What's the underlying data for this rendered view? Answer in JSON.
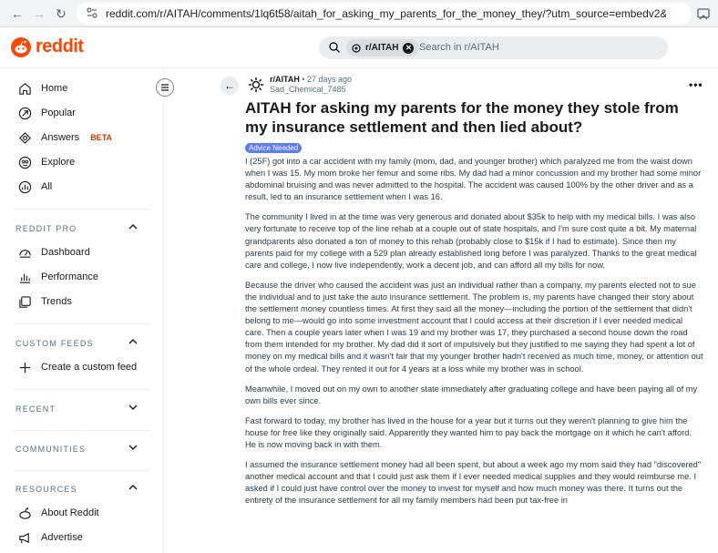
{
  "browser": {
    "url": "reddit.com/r/AITAH/comments/1lq6t58/aitah_for_asking_my_parents_for_the_money_they/?utm_source=embedv2&utm_med..."
  },
  "header": {
    "logo_text": "reddit",
    "search": {
      "chip": "r/AITAH",
      "placeholder": "Search in r/AITAH"
    }
  },
  "sidebar": {
    "main_nav": [
      {
        "label": "Home",
        "icon": "home-icon"
      },
      {
        "label": "Popular",
        "icon": "popular-icon"
      },
      {
        "label": "Answers",
        "badge": "BETA",
        "icon": "answers-icon"
      },
      {
        "label": "Explore",
        "icon": "explore-icon"
      },
      {
        "label": "All",
        "icon": "all-icon"
      }
    ],
    "reddit_pro": {
      "title": "REDDIT PRO",
      "items": [
        {
          "label": "Dashboard",
          "icon": "dashboard-icon"
        },
        {
          "label": "Performance",
          "icon": "performance-icon"
        },
        {
          "label": "Trends",
          "icon": "trends-icon"
        }
      ]
    },
    "custom_feeds": {
      "title": "CUSTOM FEEDS",
      "create_label": "Create a custom feed"
    },
    "recent": {
      "title": "RECENT"
    },
    "communities": {
      "title": "COMMUNITIES"
    },
    "resources": {
      "title": "RESOURCES",
      "items": [
        {
          "label": "About Reddit",
          "icon": "about-icon"
        },
        {
          "label": "Advertise",
          "icon": "advertise-icon"
        }
      ]
    }
  },
  "post": {
    "subreddit": "r/AITAH",
    "time": "• 27 days ago",
    "author": "Sad_Chemical_7485",
    "title": "AITAH for asking my parents for the money they stole from my insurance settlement and then lied about?",
    "flair": "Advice Needed",
    "paragraphs": [
      "I (25F) got into a car accident with my family (mom, dad, and younger brother) which paralyzed me from the waist down when I was 15. My mom broke her femur and some ribs. My dad had a minor concussion and my brother had some minor abdominal bruising and was never admitted to the hospital. The accident was caused 100% by the other driver and as a result, led to an insurance settlement when I was 16.",
      "The community I lived in at the time was very generous and donated about $35k to help with my medical bills. I was also very fortunate to receive top of the line rehab at a couple out of state hospitals, and I'm sure cost quite a bit. My maternal grandparents also donated a ton of money to this rehab (probably close to $15k if I had to estimate). Since then my parents paid for my college with a 529 plan already established long before I was paralyzed. Thanks to the great medical care and college, I now live independently, work a decent job, and can afford all my bills for now.",
      "Because the driver who caused the accident was just an individual rather than a company, my parents elected not to sue the individual and to just take the auto insurance settlement. The problem is, my parents have changed their story about the settlement money countless times. At first they said all the money—including the portion of the settlement that didn't belong to me—would go into some investment account that I could access at their discretion if I ever needed medical care. Then a couple years later when I was 19 and my brother was 17, they purchased a second house down the road from them intended for my brother. My dad did it sort of impulsively but they justified to me saying they had spent a lot of money on my medical bills and it wasn't fair that my younger brother hadn't received as much time, money, or attention out of the whole ordeal. They rented it out for 4 years at a loss while my brother was in school.",
      "Meanwhile, I moved out on my own to another state immediately after graduating college and have been paying all of my own bills ever since.",
      "Fast forward to today, my brother has lived in the house for a year but it turns out they weren't planning to give him the house for free like they originally said. Apparently they wanted him to pay back the mortgage on it which he can't afford. He is now moving back in with them.",
      "I assumed the insurance settlement money had all been spent, but about a week ago my mom said they had \"discovered\" another medical account and that I could just ask them if I ever needed medical supplies and they would reimburse me. I asked if I could just have control over the money to invest for myself and how much money was there. It turns out the entirety of the insurance settlement for all my family members had been put tax-free in"
    ]
  }
}
